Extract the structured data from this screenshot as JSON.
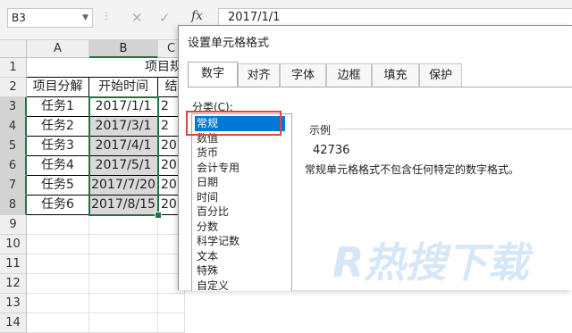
{
  "formula_bar": {
    "name_box": "B3",
    "name_box_dropdown": "▼",
    "dots": "⋮",
    "cancel_icon": "✕",
    "enter_icon": "✓",
    "fx_label": "fx",
    "formula": "2017/1/1"
  },
  "sheet": {
    "columns": [
      "A",
      "B",
      "C"
    ],
    "rows": [
      "1",
      "2",
      "3",
      "4",
      "5",
      "6",
      "7",
      "8",
      "9",
      "10",
      "11",
      "12",
      "13",
      "14"
    ],
    "merged_title": "项目规",
    "headers": [
      "项目分解",
      "开始时间",
      "结"
    ],
    "data": [
      [
        "任务1",
        "2017/1/1",
        "2"
      ],
      [
        "任务2",
        "2017/3/1",
        "2"
      ],
      [
        "任务3",
        "2017/4/1",
        "20"
      ],
      [
        "任务4",
        "2017/5/1",
        "20"
      ],
      [
        "任务5",
        "2017/7/20",
        "20"
      ],
      [
        "任务6",
        "2017/8/15",
        "20"
      ]
    ]
  },
  "dialog": {
    "title": "设置单元格格式",
    "tabs": [
      "数字",
      "对齐",
      "字体",
      "边框",
      "填充",
      "保护"
    ],
    "active_tab": "数字",
    "category_label": "分类(C):",
    "categories": [
      "常规",
      "数值",
      "货币",
      "会计专用",
      "日期",
      "时间",
      "百分比",
      "分数",
      "科学记数",
      "文本",
      "特殊",
      "自定义"
    ],
    "selected_category": "常规",
    "sample_label": "示例",
    "sample_value": "42736",
    "description": "常规单元格格式不包含任何特定的数字格式。"
  },
  "watermark": {
    "text": "R热搜下载"
  },
  "colors": {
    "excel_green": "#217346",
    "selection_blue": "#0078d7",
    "highlight_red": "#e04545",
    "watermark_blue": "#cfe3f6"
  }
}
